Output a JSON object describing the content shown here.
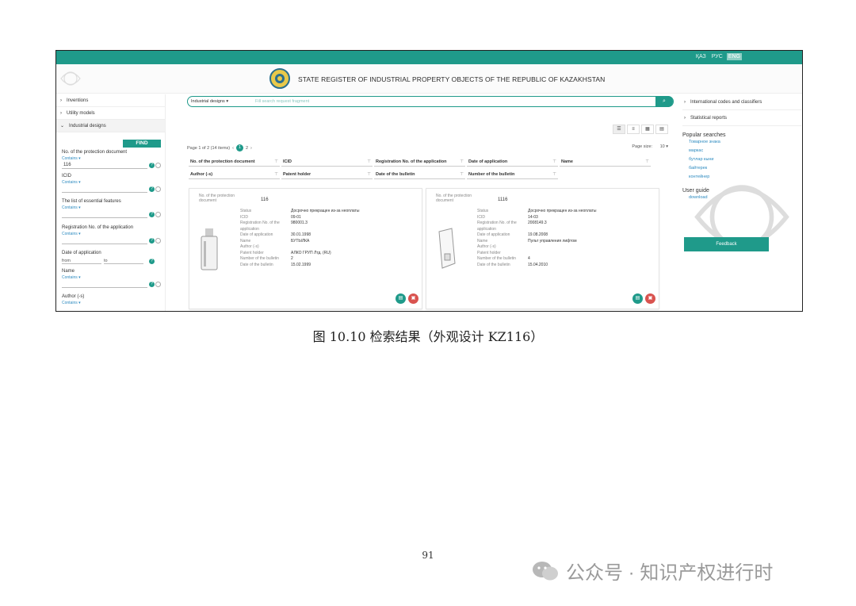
{
  "topbar": {
    "languages": [
      "ҚАЗ",
      "РУС",
      "ENG"
    ]
  },
  "header": {
    "title": "STATE REGISTER OF INDUSTRIAL PROPERTY OBJECTS OF THE REPUBLIC OF KAZAKHSTAN"
  },
  "sidebar": {
    "items": [
      "Inventions",
      "Utility models",
      "Industrial designs"
    ],
    "find_label": "FIND",
    "contains": "Contains ▾",
    "fields": {
      "protection_doc_label": "No. of the protection document",
      "protection_doc_value": "116",
      "icid_label": "ICID",
      "features_label": "The list of essential features",
      "reg_no_label": "Registration No. of the application",
      "date_label": "Date of application",
      "date_from": "from",
      "date_to": "to",
      "name_label": "Name",
      "author_label": "Author (-s)"
    }
  },
  "main": {
    "search_type": "Industrial designs ▾",
    "search_placeholder": "Fill search request fragment",
    "pager_text": "Page 1 of 2 (14 items)",
    "pager_current": "1",
    "pager_next": "2",
    "page_size_label": "Page size:",
    "page_size_value": "10",
    "filters": [
      "No. of the protection document",
      "ICID",
      "Registration No. of the application",
      "Date of application",
      "Name",
      "Author (-s)",
      "Patent holder",
      "Date of the bulletin",
      "Number of the bulletin"
    ]
  },
  "cards": [
    {
      "doc_label": "No. of the protection document",
      "doc_value": "116",
      "rows": [
        {
          "k": "Status",
          "v": "Досрочно прекращен из-за неоплаты"
        },
        {
          "k": "ICID",
          "v": "09-01"
        },
        {
          "k": "Registration No. of the application",
          "v": "980001.3"
        },
        {
          "k": "Date of application",
          "v": "30.01.1998"
        },
        {
          "k": "Name",
          "v": "БУТЫЛКА"
        },
        {
          "k": "Author (-s)",
          "v": ""
        },
        {
          "k": "Patent holder",
          "v": "АЛКО ГРУП Лтд. (RU)"
        },
        {
          "k": "Number of the bulletin",
          "v": "2"
        },
        {
          "k": "Date of the bulletin",
          "v": "15.02.1999"
        }
      ]
    },
    {
      "doc_label": "No. of the protection document",
      "doc_value": "1116",
      "rows": [
        {
          "k": "Status",
          "v": "Досрочно прекращен из-за неоплаты"
        },
        {
          "k": "ICID",
          "v": "14-03"
        },
        {
          "k": "Registration No. of the application",
          "v": "2008149.3"
        },
        {
          "k": "Date of application",
          "v": "19.08.2008"
        },
        {
          "k": "Name",
          "v": "Пульт управления лифтом"
        },
        {
          "k": "Author (-s)",
          "v": ""
        },
        {
          "k": "Patent holder",
          "v": ""
        },
        {
          "k": "Number of the bulletin",
          "v": "4"
        },
        {
          "k": "Date of the bulletin",
          "v": "15.04.2010"
        }
      ]
    }
  ],
  "right": {
    "links": [
      "International codes and classifiers",
      "Statistical reports"
    ],
    "popular_title": "Popular searches",
    "popular": [
      "Товарное знака",
      "маркас",
      "бутлар кыни",
      "байтерек",
      "контейнер"
    ],
    "guide_title": "User guide",
    "guide_link": "download",
    "feedback": "Feedback"
  },
  "caption": "图 10.10  检索结果（外观设计 KZ116）",
  "page_number": "91",
  "watermark": "公众号 · 知识产权进行时"
}
